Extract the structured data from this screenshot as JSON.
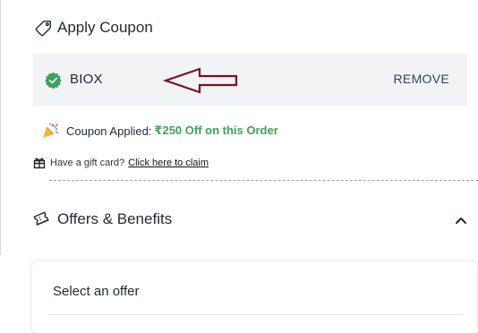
{
  "apply_coupon": {
    "title": "Apply Coupon",
    "icon": "tag-icon"
  },
  "coupon": {
    "code": "BIOX",
    "remove_label": "REMOVE",
    "status_icon": "check-badge-icon",
    "status_color": "#3aa35a",
    "annotation": "arrow-pointer-icon",
    "annotation_color": "#7a1026"
  },
  "applied": {
    "icon": "party-popper-icon",
    "label": "Coupon Applied:",
    "value": "₹250 Off on this Order",
    "value_color": "#3aa35a"
  },
  "gift_card": {
    "icon": "gift-icon",
    "text": "Have a gift card?",
    "link": "Click here to claim"
  },
  "offers": {
    "title": "Offers & Benefits",
    "icon": "ticket-icon",
    "expanded": true,
    "select_label": "Select an offer"
  }
}
